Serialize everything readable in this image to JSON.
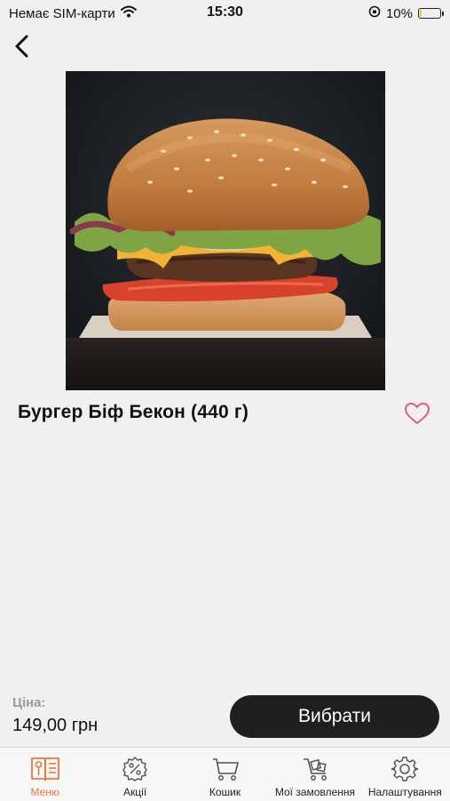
{
  "status_bar": {
    "carrier": "Немає SIM-карти",
    "time": "15:30",
    "battery": "10%",
    "battery_level": 0.1
  },
  "product": {
    "title": "Бургер Біф Бекон (440 г)",
    "image_icon": "burger-photo"
  },
  "price": {
    "label": "Ціна:",
    "value": "149,00 грн"
  },
  "actions": {
    "select_label": "Вибрати"
  },
  "tabs": [
    {
      "label": "Меню",
      "icon": "menu-book-icon",
      "active": true
    },
    {
      "label": "Акції",
      "icon": "discount-icon",
      "active": false
    },
    {
      "label": "Кошик",
      "icon": "cart-icon",
      "active": false
    },
    {
      "label": "Мої замовлення",
      "icon": "orders-icon",
      "active": false
    },
    {
      "label": "Налаштування",
      "icon": "settings-icon",
      "active": false
    }
  ],
  "colors": {
    "accent": "#e8783a",
    "button_bg": "#1f1f1f",
    "favorite": "#e45a7a",
    "background": "#f0f0f0"
  }
}
